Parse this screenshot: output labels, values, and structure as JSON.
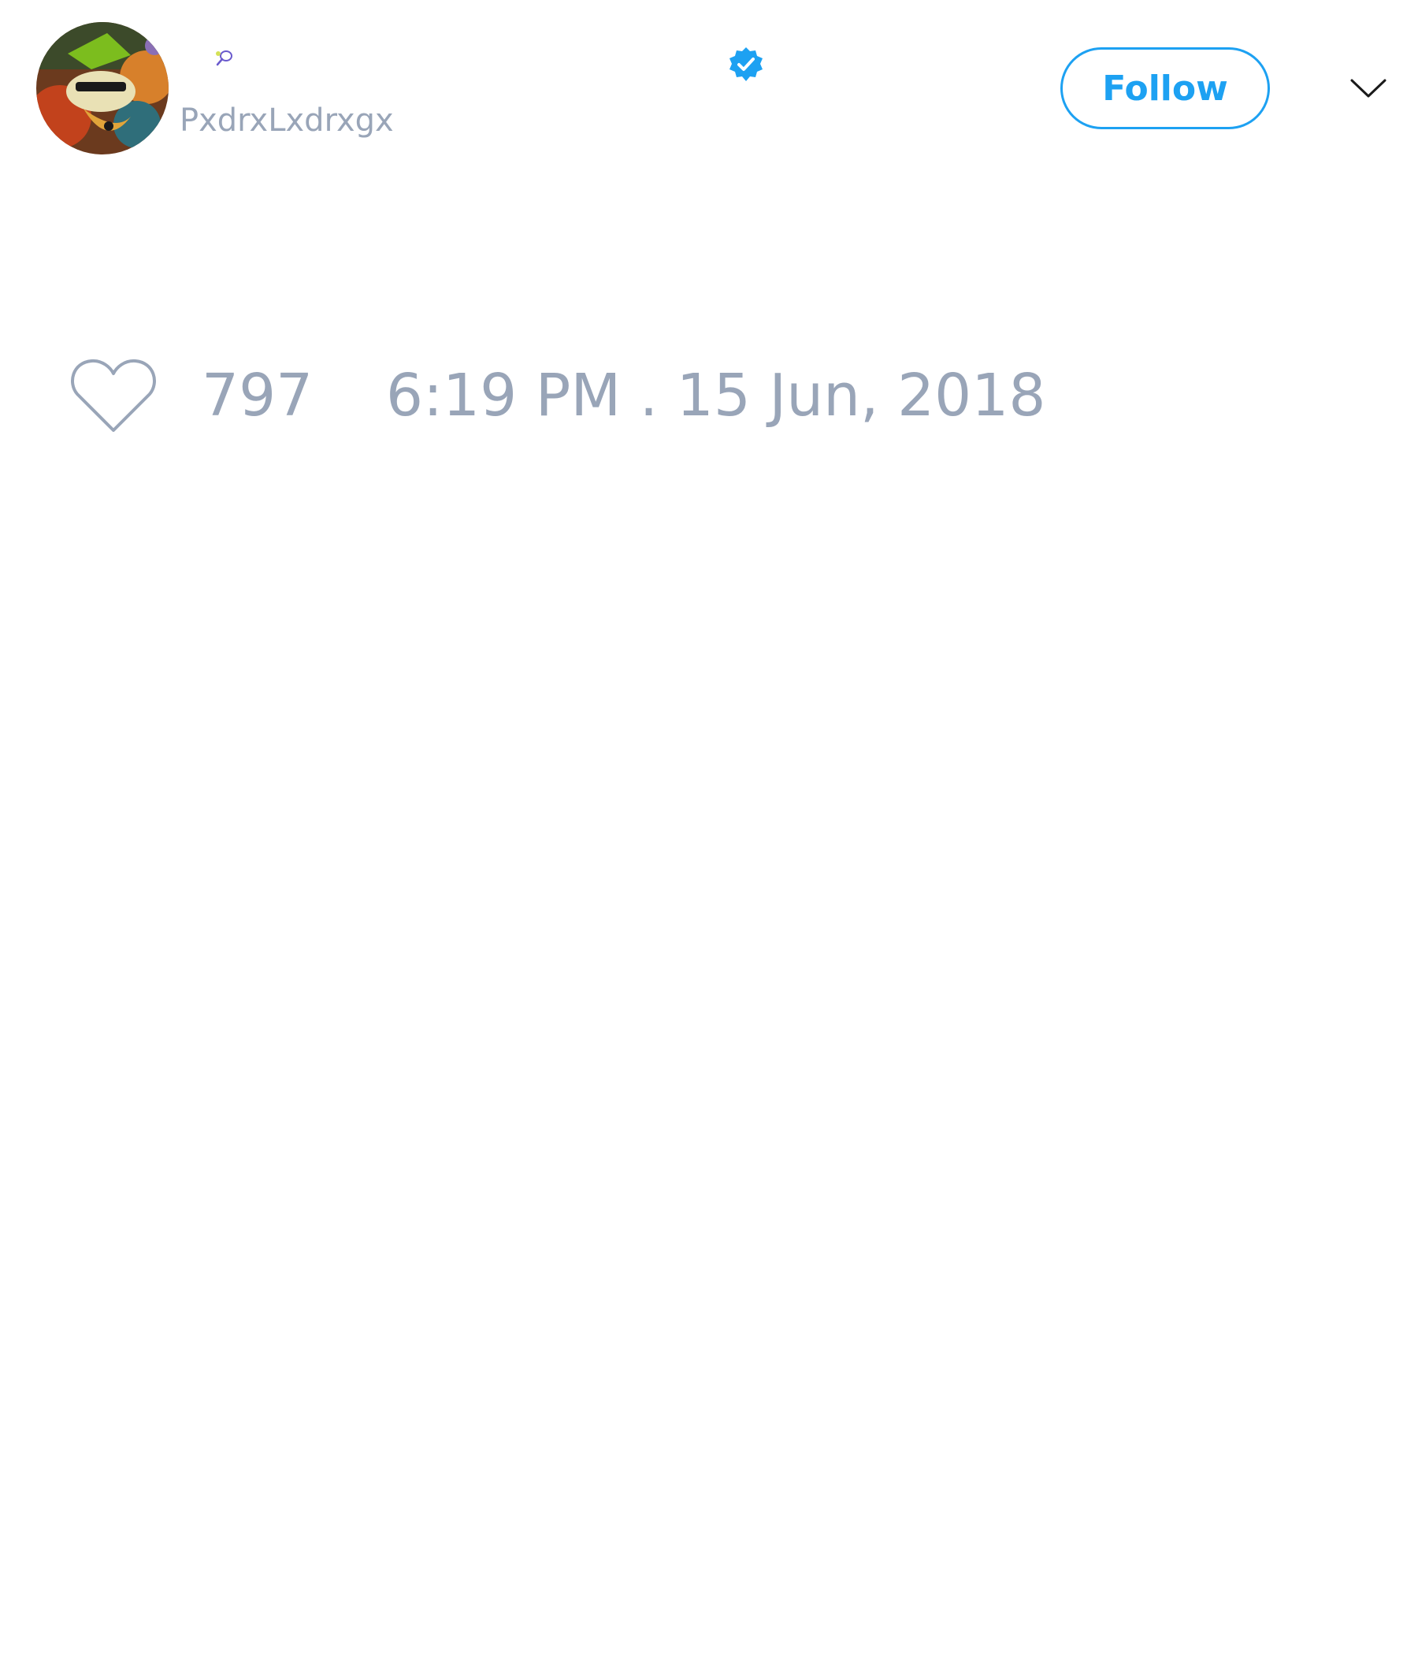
{
  "tweet": {
    "author": {
      "handle": "PxdrxLxdrxgx",
      "verified": true,
      "name_emoji_icon": "tennis-racket-icon",
      "avatar_icon": "cartoon-avatar"
    },
    "follow_label": "Follow",
    "menu_icon": "chevron-down-icon",
    "like_icon": "heart-outline-icon",
    "like_count": "797",
    "timestamp": "6:19 PM . 15 Jun, 2018"
  },
  "colors": {
    "accent": "#1da1f2",
    "muted_text": "#99a5b8",
    "background": "#ffffff"
  }
}
